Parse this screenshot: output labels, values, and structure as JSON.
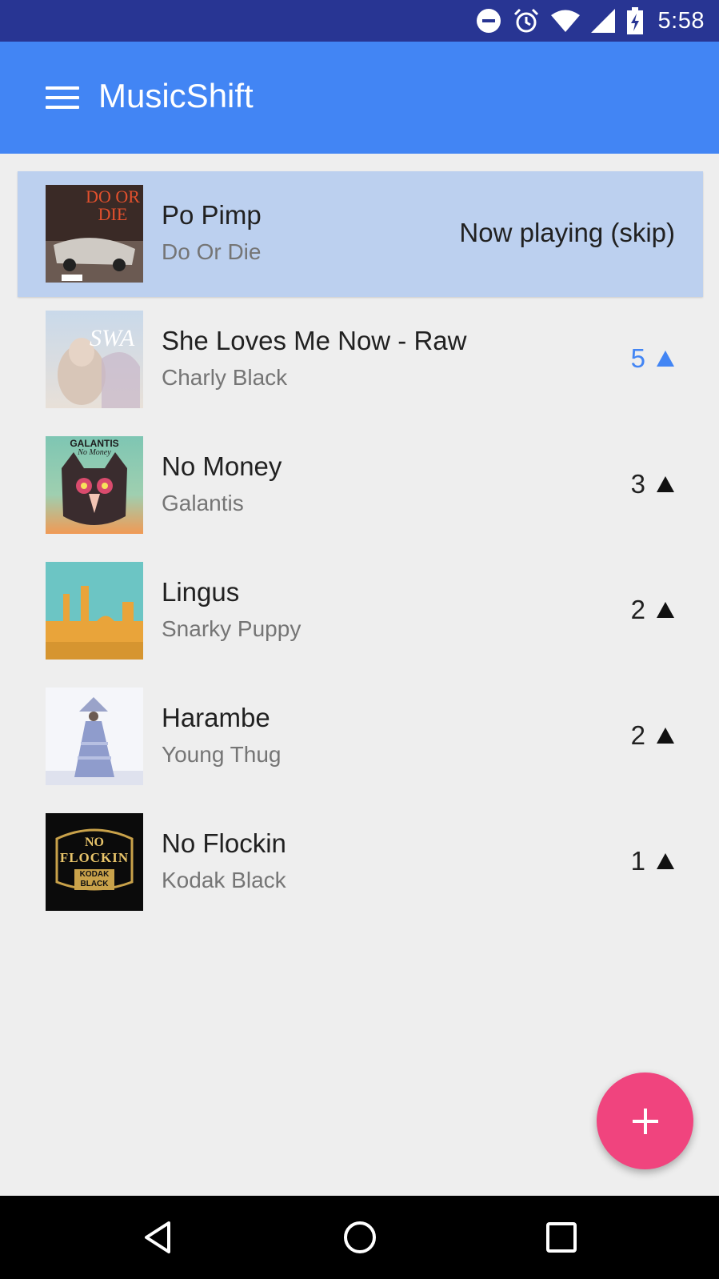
{
  "status_bar": {
    "time": "5:58",
    "icons": [
      "do-not-disturb-icon",
      "alarm-icon",
      "wifi-icon",
      "cell-signal-icon",
      "battery-charging-icon"
    ]
  },
  "app_bar": {
    "title": "MusicShift",
    "menu_icon": "hamburger-menu-icon"
  },
  "queue": [
    {
      "song": "Po Pimp",
      "artist": "Do Or Die",
      "status": "Now playing (skip)",
      "now_playing": true
    },
    {
      "song": "She Loves Me Now - Raw",
      "artist": "Charly Black",
      "votes": "5",
      "voted": true
    },
    {
      "song": "No Money",
      "artist": "Galantis",
      "votes": "3",
      "voted": false
    },
    {
      "song": "Lingus",
      "artist": "Snarky Puppy",
      "votes": "2",
      "voted": false
    },
    {
      "song": "Harambe",
      "artist": "Young Thug",
      "votes": "2",
      "voted": false
    },
    {
      "song": "No Flockin",
      "artist": "Kodak Black",
      "votes": "1",
      "voted": false
    }
  ],
  "album_art_text": {
    "do_or_die": "DO OR DIE",
    "swa": "SWA",
    "galantis": "GALANTIS",
    "galantis_sub": "No Money",
    "no_flockin_1": "NO",
    "no_flockin_2": "FLOCKIN",
    "no_flockin_3": "KODAK",
    "no_flockin_4": "BLACK"
  },
  "colors": {
    "status_bar": "#283593",
    "app_bar": "#4285f4",
    "now_playing_row": "#bcd0ef",
    "voted_accent": "#4285f4",
    "fab": "#f0447e"
  },
  "fab_icon": "plus-icon",
  "nav_bar": [
    "back-icon",
    "home-icon",
    "recents-icon"
  ]
}
